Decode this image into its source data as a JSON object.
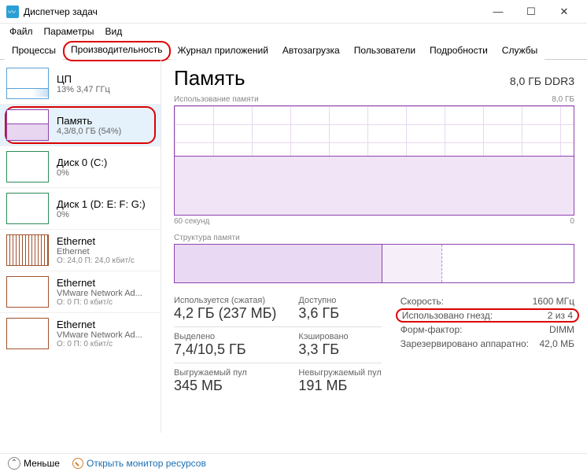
{
  "window": {
    "title": "Диспетчер задач"
  },
  "menu": {
    "file": "Файл",
    "options": "Параметры",
    "view": "Вид"
  },
  "tabs": {
    "processes": "Процессы",
    "performance": "Производительность",
    "apphistory": "Журнал приложений",
    "startup": "Автозагрузка",
    "users": "Пользователи",
    "details": "Подробности",
    "services": "Службы"
  },
  "sidebar": {
    "cpu": {
      "title": "ЦП",
      "sub": "13% 3,47 ГГц"
    },
    "memory": {
      "title": "Память",
      "sub": "4,3/8,0 ГБ (54%)"
    },
    "disk0": {
      "title": "Диск 0 (C:)",
      "sub": "0%"
    },
    "disk1": {
      "title": "Диск 1 (D: E: F: G:)",
      "sub": "0%"
    },
    "eth0": {
      "title": "Ethernet",
      "sub": "Ethernet",
      "sub2": "О: 24,0 П: 24,0 кбит/с"
    },
    "eth1": {
      "title": "Ethernet",
      "sub": "VMware Network Ad...",
      "sub2": "О: 0 П: 0 кбит/с"
    },
    "eth2": {
      "title": "Ethernet",
      "sub": "VMware Network Ad...",
      "sub2": "О: 0 П: 0 кбит/с"
    }
  },
  "main": {
    "title": "Память",
    "spec": "8,0 ГБ DDR3",
    "chart1_label": "Использование памяти",
    "chart1_max": "8,0 ГБ",
    "axis_left": "60 секунд",
    "axis_right": "0",
    "chart2_label": "Структура памяти",
    "stats": {
      "inuse_label": "Используется (сжатая)",
      "inuse_value": "4,2 ГБ (237 МБ)",
      "avail_label": "Доступно",
      "avail_value": "3,6 ГБ",
      "committed_label": "Выделено",
      "committed_value": "7,4/10,5 ГБ",
      "cached_label": "Кэшировано",
      "cached_value": "3,3 ГБ",
      "paged_label": "Выгружаемый пул",
      "paged_value": "345 МБ",
      "nonpaged_label": "Невыгружаемый пул",
      "nonpaged_value": "191 МБ"
    },
    "kv": {
      "speed_k": "Скорость:",
      "speed_v": "1600 МГц",
      "slots_k": "Использовано гнезд:",
      "slots_v": "2 из 4",
      "form_k": "Форм-фактор:",
      "form_v": "DIMM",
      "hw_k": "Зарезервировано аппаратно:",
      "hw_v": "42,0 МБ"
    }
  },
  "footer": {
    "fewer": "Меньше",
    "resmon": "Открыть монитор ресурсов"
  },
  "chart_data": {
    "type": "area",
    "title": "Использование памяти",
    "xlabel": "60 секунд",
    "ylabel": "ГБ",
    "ylim": [
      0,
      8.0
    ],
    "x": [
      60,
      50,
      40,
      30,
      20,
      10,
      0
    ],
    "values": [
      4.3,
      4.3,
      4.3,
      4.3,
      4.3,
      4.3,
      4.3
    ],
    "series_name": "Используется"
  }
}
